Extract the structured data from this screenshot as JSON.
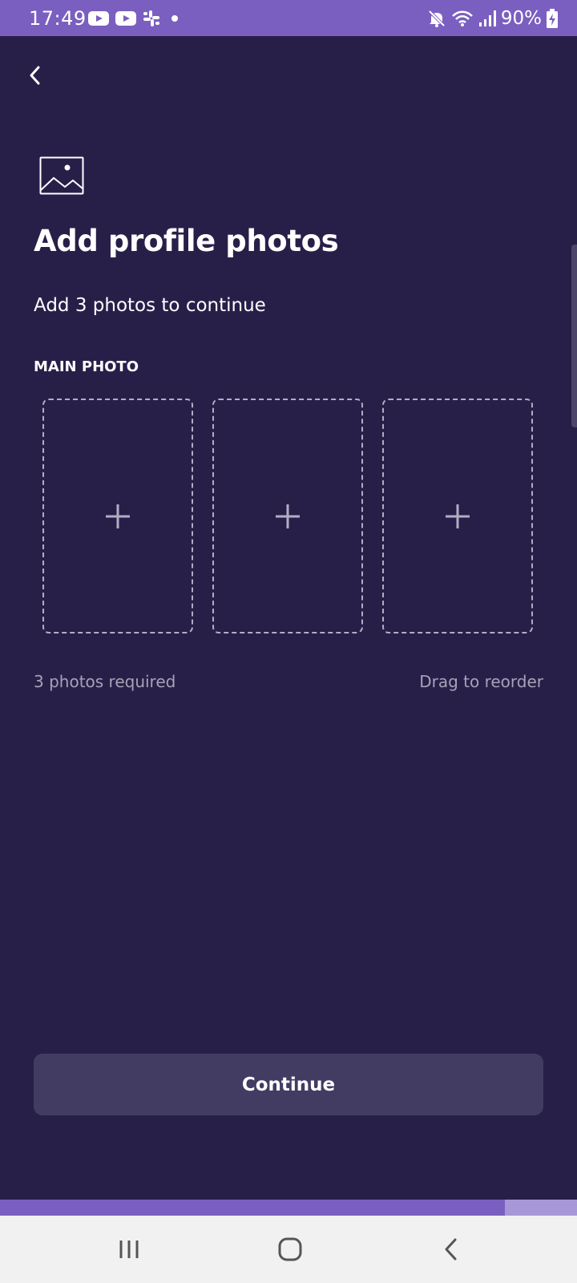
{
  "status_bar": {
    "time": "17:49",
    "battery": "90%",
    "background_color": "#7A5FC0",
    "left_icons": [
      "youtube-icon",
      "youtube-icon",
      "slack-icon",
      "notification-dot-icon"
    ],
    "right_icons": [
      "mute-icon",
      "wifi-icon",
      "signal-icon",
      "battery-charging-icon"
    ]
  },
  "header": {
    "back_icon": "chevron-left-icon",
    "image_icon": "image-icon"
  },
  "main": {
    "title": "Add profile photos",
    "subtitle": "Add 3 photos to continue",
    "section_label": "MAIN PHOTO",
    "photo_slots": [
      {
        "icon": "plus-icon",
        "filled": false
      },
      {
        "icon": "plus-icon",
        "filled": false
      },
      {
        "icon": "plus-icon",
        "filled": false
      }
    ],
    "hint_left": "3 photos required",
    "hint_right": "Drag to reorder"
  },
  "footer": {
    "continue_label": "Continue",
    "continue_enabled": false,
    "progress": 0.875
  },
  "nav_bar": {
    "icons": [
      "recents-icon",
      "home-icon",
      "back-icon"
    ]
  },
  "colors": {
    "background": "#281F49",
    "accent": "#7A5FC0",
    "button_disabled": "#423B62",
    "muted_text": "#A7A2B7"
  }
}
